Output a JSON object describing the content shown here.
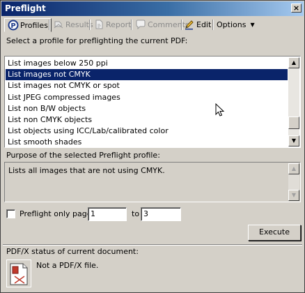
{
  "window": {
    "title": "Preflight",
    "close_symbol": "×"
  },
  "toolbar": {
    "tabs": [
      {
        "label": "Profiles",
        "icon": "preflight-icon",
        "active": true
      },
      {
        "label": "Results",
        "icon": "results-icon",
        "disabled": true
      },
      {
        "label": "Report",
        "icon": "report-icon",
        "disabled": true
      },
      {
        "label": "Comments",
        "icon": "comments-icon",
        "disabled": true
      },
      {
        "label": "Edit",
        "icon": "edit-pencil-icon"
      },
      {
        "label": "Options",
        "icon": "dropdown-caret"
      }
    ],
    "caret": "▼"
  },
  "profiles": {
    "prompt": "Select a profile for preflighting the current PDF:",
    "items": [
      "List images below 250 ppi",
      "List images not CMYK",
      "List images not CMYK or spot",
      "List JPEG compressed images",
      "List non B/W objects",
      "List non CMYK objects",
      "List objects using ICC/Lab/calibrated color",
      "List smooth shades"
    ],
    "selected": "List images not CMYK",
    "scroll_up": "▲",
    "scroll_down": "▼"
  },
  "purpose": {
    "label": "Purpose of the selected Preflight profile:",
    "text": "Lists all images that are not using CMYK."
  },
  "page_range": {
    "checkbox_label": "Preflight only pages",
    "from": "1",
    "to_label": "to",
    "to": "3"
  },
  "execute_label": "Execute",
  "pdfx": {
    "label": "PDF/X status of current document:",
    "status": "Not a PDF/X file."
  },
  "colors": {
    "selection": "#0a246a",
    "window_bg": "#d4d0c8",
    "title_gradient_start": "#0a246a"
  }
}
